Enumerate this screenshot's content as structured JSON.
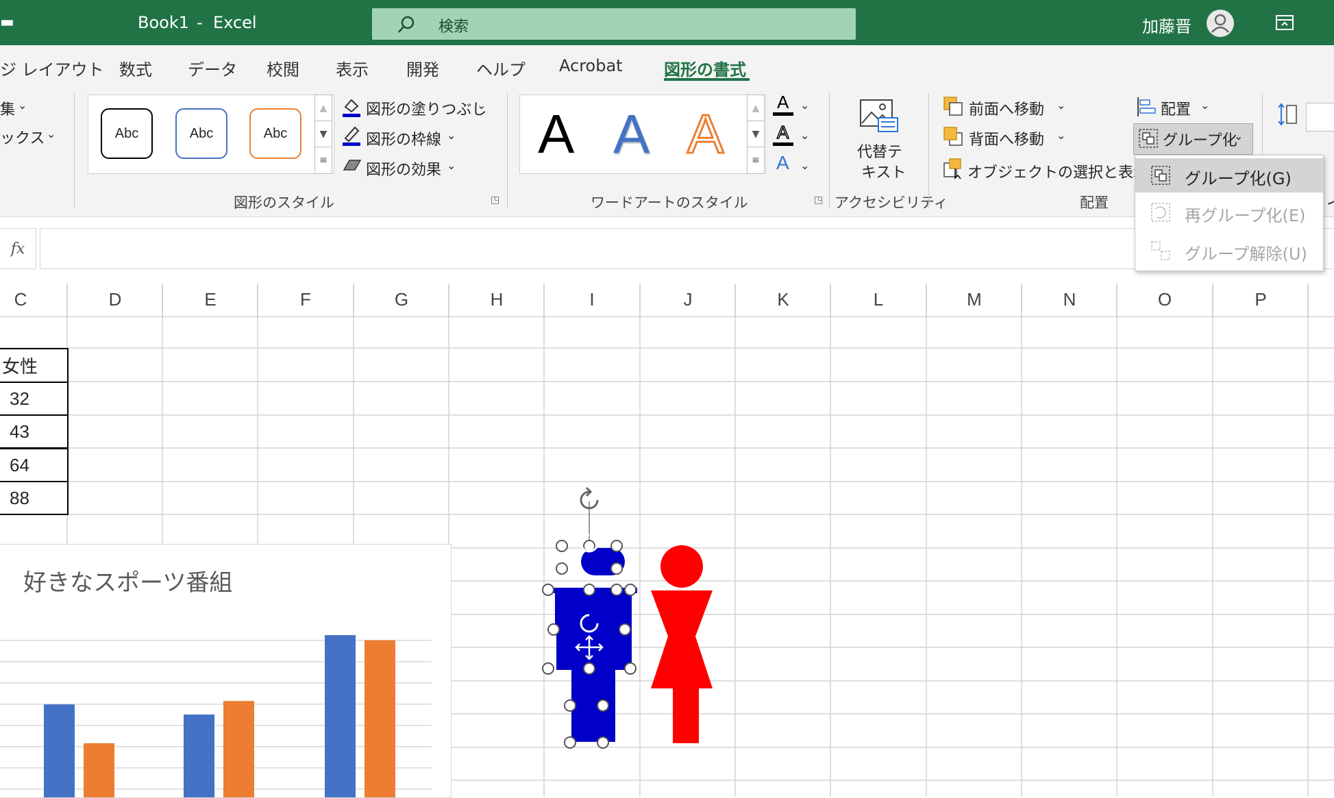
{
  "titlebar": {
    "file": "Book1",
    "sep": "-",
    "app": "Excel",
    "search_placeholder": "検索",
    "user": "加藤晋"
  },
  "tabs": {
    "page_layout": "ジ レイアウト",
    "formulas": "数式",
    "data": "データ",
    "review": "校閲",
    "view": "表示",
    "developer": "開発",
    "help": "ヘルプ",
    "acrobat": "Acrobat",
    "shape_format": "図形の書式"
  },
  "ribbon": {
    "edit_cut": "集",
    "textbox_cut": "ックス",
    "abc": "Abc",
    "shape_fill": "図形の塗りつぶし",
    "shape_outline": "図形の枠線",
    "shape_effects": "図形の効果",
    "shape_styles_label": "図形のスタイル",
    "wordart_letter": "A",
    "wordart_styles_label": "ワードアートのスタイル",
    "alt_text_line1": "代替テ",
    "alt_text_line2": "キスト",
    "accessibility_label": "アクセシビリティ",
    "bring_forward": "前面へ移動",
    "send_backward": "背面へ移動",
    "selection_pane": "オブジェクトの選択と表示",
    "arrange_label": "配置",
    "align": "配置",
    "group": "グループ化",
    "size_cut": "イ"
  },
  "group_menu": {
    "items": [
      {
        "label": "グループ化(G)",
        "enabled": true
      },
      {
        "label": "再グループ化(E)",
        "enabled": false
      },
      {
        "label": "グループ解除(U)",
        "enabled": false
      }
    ]
  },
  "formula_bar": {
    "fx": "fx",
    "value": ""
  },
  "columns": [
    "C",
    "D",
    "E",
    "F",
    "G",
    "H",
    "I",
    "J",
    "K",
    "L",
    "M",
    "N",
    "O",
    "P"
  ],
  "table": {
    "header": "女性",
    "values": [
      "32",
      "43",
      "64",
      "88"
    ]
  },
  "chart_data": {
    "type": "bar",
    "title": "好きなスポーツ番組",
    "series": [
      {
        "color": "#4472c4",
        "values": [
          55,
          49,
          96
        ]
      },
      {
        "color": "#ed7d31",
        "values": [
          32,
          57,
          93
        ]
      }
    ]
  },
  "shapes": {
    "male_color": "#0000c8",
    "female_color": "#ff0000"
  },
  "colors": {
    "excel_green": "#217346",
    "search_bg": "#a2d4b4"
  }
}
